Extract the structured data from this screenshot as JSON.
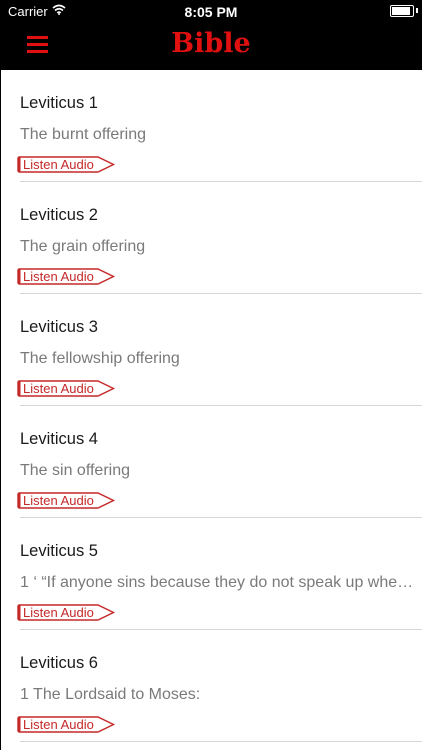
{
  "status_bar": {
    "carrier": "Carrier",
    "time": "8:05 PM",
    "battery_level": 1.0
  },
  "nav": {
    "title": "Bible",
    "menu_icon": "hamburger-menu-icon",
    "accent_color": "#e01010"
  },
  "chapters": [
    {
      "title": "Leviticus 1",
      "description": "The burnt offering",
      "audio_label": "Listen Audio"
    },
    {
      "title": "Leviticus 2",
      "description": "The grain offering",
      "audio_label": "Listen Audio"
    },
    {
      "title": "Leviticus 3",
      "description": "The fellowship offering",
      "audio_label": "Listen Audio"
    },
    {
      "title": "Leviticus 4",
      "description": "The sin offering",
      "audio_label": "Listen Audio"
    },
    {
      "title": "Leviticus 5",
      "description": "1 ‘ “If anyone sins because they do not speak up whe…",
      "audio_label": "Listen Audio"
    },
    {
      "title": "Leviticus 6",
      "description": "1 The Lordsaid to Moses:",
      "audio_label": "Listen Audio"
    }
  ]
}
